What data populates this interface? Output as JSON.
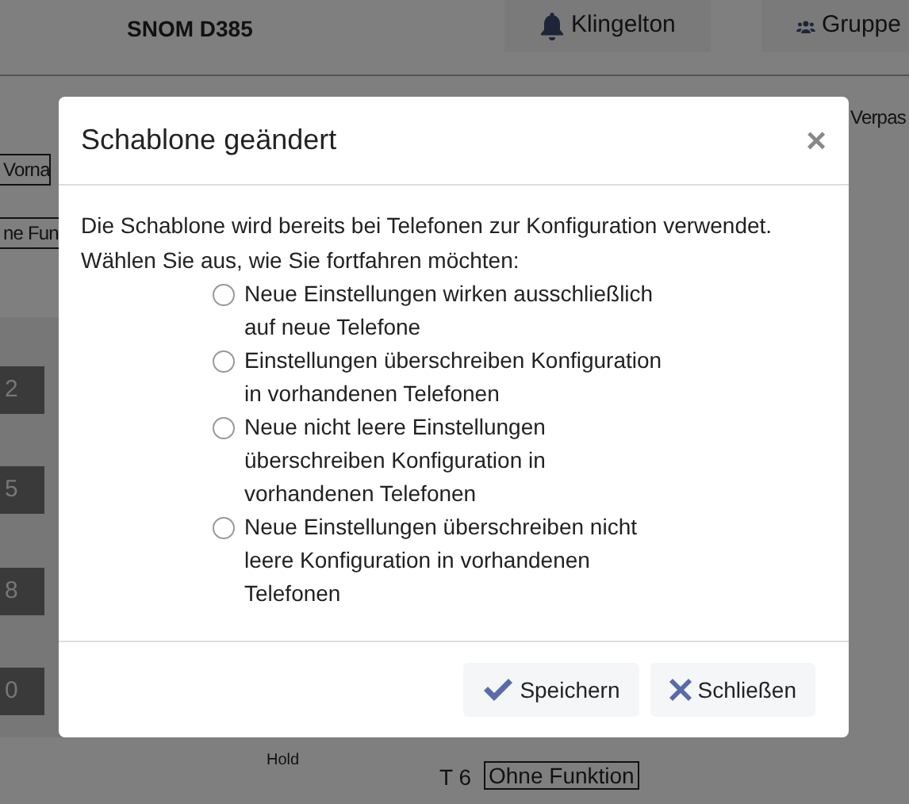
{
  "page": {
    "device_title": "SNOM D385",
    "header_buttons": [
      {
        "label": "Klingelton",
        "kind": "bell"
      },
      {
        "label": "Gruppe",
        "kind": "users"
      }
    ],
    "side_label": "Verpas",
    "fields": [
      "Vorna",
      "ne Fun"
    ],
    "keys": [
      "2",
      "5",
      "8",
      "0"
    ],
    "hold_label": "Hold",
    "key_label": "T 6",
    "key_value": "Ohne Funktion"
  },
  "dialog": {
    "title": "Schablone geändert",
    "close": "×",
    "message": "Die Schablone wird bereits bei Telefonen zur Konfiguration verwendet. Wählen Sie aus, wie Sie fortfahren möchten:",
    "options": [
      {
        "label": "Neue Einstellungen wirken ausschließlich auf neue Telefone",
        "selected": false
      },
      {
        "label": "Einstellungen überschreiben Konfiguration in vorhandenen Telefonen",
        "selected": false
      },
      {
        "label": "Neue nicht leere Einstellungen überschreiben Konfiguration in vorhandenen Telefonen",
        "selected": false
      },
      {
        "label": "Neue Einstellungen überschreiben nicht leere Konfiguration in vorhandenen Telefonen",
        "selected": false
      }
    ],
    "buttons": [
      {
        "label": "Speichern",
        "kind": "save"
      },
      {
        "label": "Schließen",
        "kind": "close"
      }
    ]
  }
}
